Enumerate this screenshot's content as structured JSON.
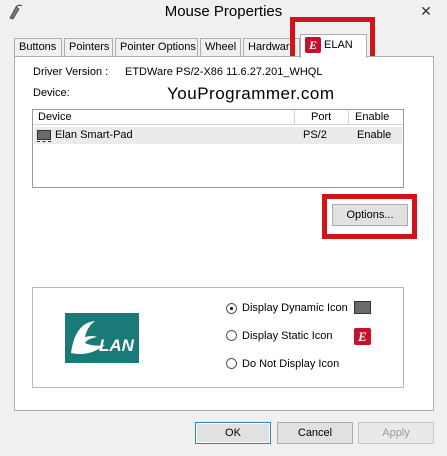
{
  "window": {
    "title": "Mouse Properties",
    "close_glyph": "✕"
  },
  "tabs": [
    {
      "label": "Buttons"
    },
    {
      "label": "Pointers"
    },
    {
      "label": "Pointer Options"
    },
    {
      "label": "Wheel"
    },
    {
      "label": "Hardware"
    },
    {
      "label": "ELAN",
      "active": true
    }
  ],
  "elan_panel": {
    "driver_version_label": "Driver Version :",
    "driver_version_value": "ETDWare PS/2-X86 11.6.27.201_WHQL",
    "device_label": "Device:",
    "watermark": "YouProgrammer.com",
    "table": {
      "headers": [
        "Device",
        "Port",
        "Enable"
      ],
      "rows": [
        {
          "device": "Elan Smart-Pad",
          "port": "PS/2",
          "enable": "Enable",
          "selected": true
        }
      ]
    },
    "options_button": "Options...",
    "logo_text": "LAN",
    "logo_letter": "E",
    "display_options": [
      {
        "label": "Display Dynamic Icon",
        "selected": true,
        "icon": "touchpad-icon"
      },
      {
        "label": "Display Static Icon",
        "selected": false,
        "icon": "elan-icon"
      },
      {
        "label": "Do Not Display Icon",
        "selected": false
      }
    ]
  },
  "footer": {
    "ok": "OK",
    "cancel": "Cancel",
    "apply": "Apply"
  },
  "colors": {
    "highlight_box": "#d0141c",
    "elan_red": "#c8102e",
    "elan_teal": "#1a7a78"
  }
}
